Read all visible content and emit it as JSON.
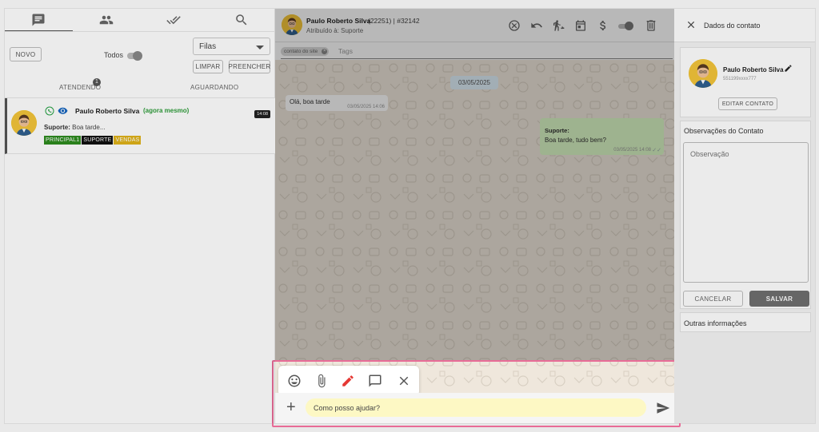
{
  "left": {
    "tabs": [
      {
        "icon": "chat-icon"
      },
      {
        "icon": "people-icon"
      },
      {
        "icon": "double-check-icon"
      },
      {
        "icon": "search-icon"
      }
    ],
    "new_label": "NOVO",
    "all_label": "Todos",
    "queue_select": "Filas",
    "clear_label": "LIMPAR",
    "fill_label": "PREENCHER",
    "subtabs": {
      "attending": "ATENDENDO",
      "attending_count": "1",
      "waiting": "AGUARDANDO"
    },
    "ticket": {
      "name": "Paulo Roberto Silva",
      "when": "(agora mesmo)",
      "time": "14:08",
      "preview_sender": "Suporte:",
      "preview_text": "Boa tarde...",
      "tags": [
        {
          "label": "PRINCIPAL1",
          "color": "#2e8b1f"
        },
        {
          "label": "SUPORTE",
          "color": "#111111"
        },
        {
          "label": "VENDAS",
          "color": "#e0b21a"
        }
      ]
    }
  },
  "chat": {
    "header": {
      "name": "Paulo Roberto Silva",
      "ids": "(22251) | #32142",
      "assigned": "Atribuído à: Suporte"
    },
    "tag_chip": "contato do site",
    "tags_placeholder": "Tags",
    "date": "03/05/2025",
    "messages": [
      {
        "direction": "in",
        "text": "Olá, boa tarde",
        "time": "03/05/2025 14:06"
      },
      {
        "direction": "out",
        "sender": "Suporte:",
        "text": "Boa tarde, tudo bem?",
        "time": "03/05/2025 14:08"
      }
    ],
    "input_value": "Como posso ajudar?"
  },
  "right": {
    "title": "Dados do contato",
    "contact_name": "Paulo Roberto Silva",
    "contact_phone": "551199xxxx777",
    "edit_label": "EDITAR CONTATO",
    "obs_title": "Observações do Contato",
    "obs_placeholder": "Observação",
    "cancel_label": "CANCELAR",
    "save_label": "SALVAR",
    "other_info": "Outras informações"
  },
  "colors": {
    "accent_highlight": "#e86c97",
    "online_green": "#2e9d3a",
    "out_bubble": "#dcf8c6",
    "input_bg": "#fdf8c4"
  }
}
